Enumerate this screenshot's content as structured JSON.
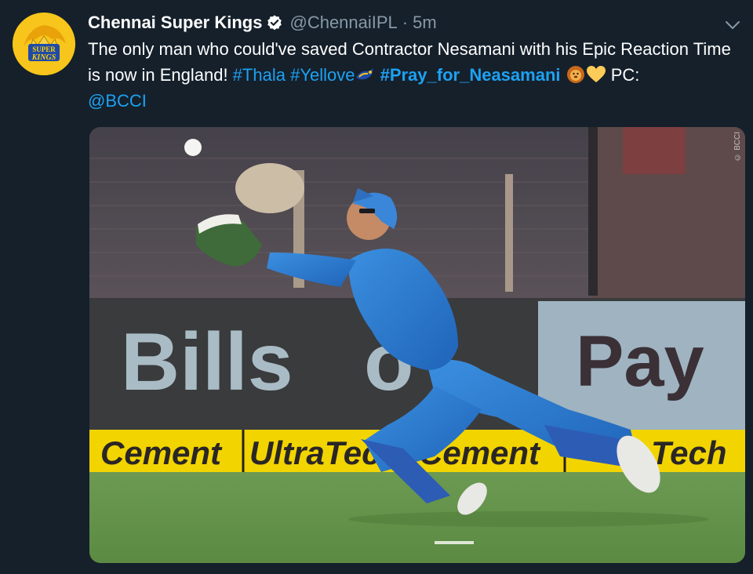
{
  "tweet": {
    "author_name": "Chennai Super Kings",
    "handle": "@ChennaiIPL",
    "separator": "·",
    "time": "5m",
    "text_part1": "The only man who could've saved Contractor Nesamani with his Epic Reaction Time is now in England! ",
    "hashtag_thala": "#Thala",
    "hashtag_yellove": "#Yellove",
    "hashtag_pray": "#Pray_for_Neasamani",
    "text_part2": " PC: ",
    "mention_bcci": "@BCCI",
    "icons": {
      "verified": "verified-badge-icon",
      "more": "chevron-down-icon",
      "emoji_lion": "lion-face-icon",
      "emoji_heart": "yellow-heart-icon",
      "emoji_whistle": "csk-whistle-icon"
    }
  },
  "avatar": {
    "logo_text_1": "SUPER",
    "logo_text_2": "KINGS"
  },
  "media": {
    "watermark": "© BCCI",
    "banner_left": "Bills",
    "banner_mid": "o",
    "banner_right": "Pay",
    "board_1": "Cement",
    "board_2": "UltraTec",
    "board_3": "Cement",
    "board_4": "Tech"
  },
  "colors": {
    "background": "#15202b",
    "link": "#1da1f2",
    "secondary": "#8899a6",
    "text": "#ffffff"
  }
}
